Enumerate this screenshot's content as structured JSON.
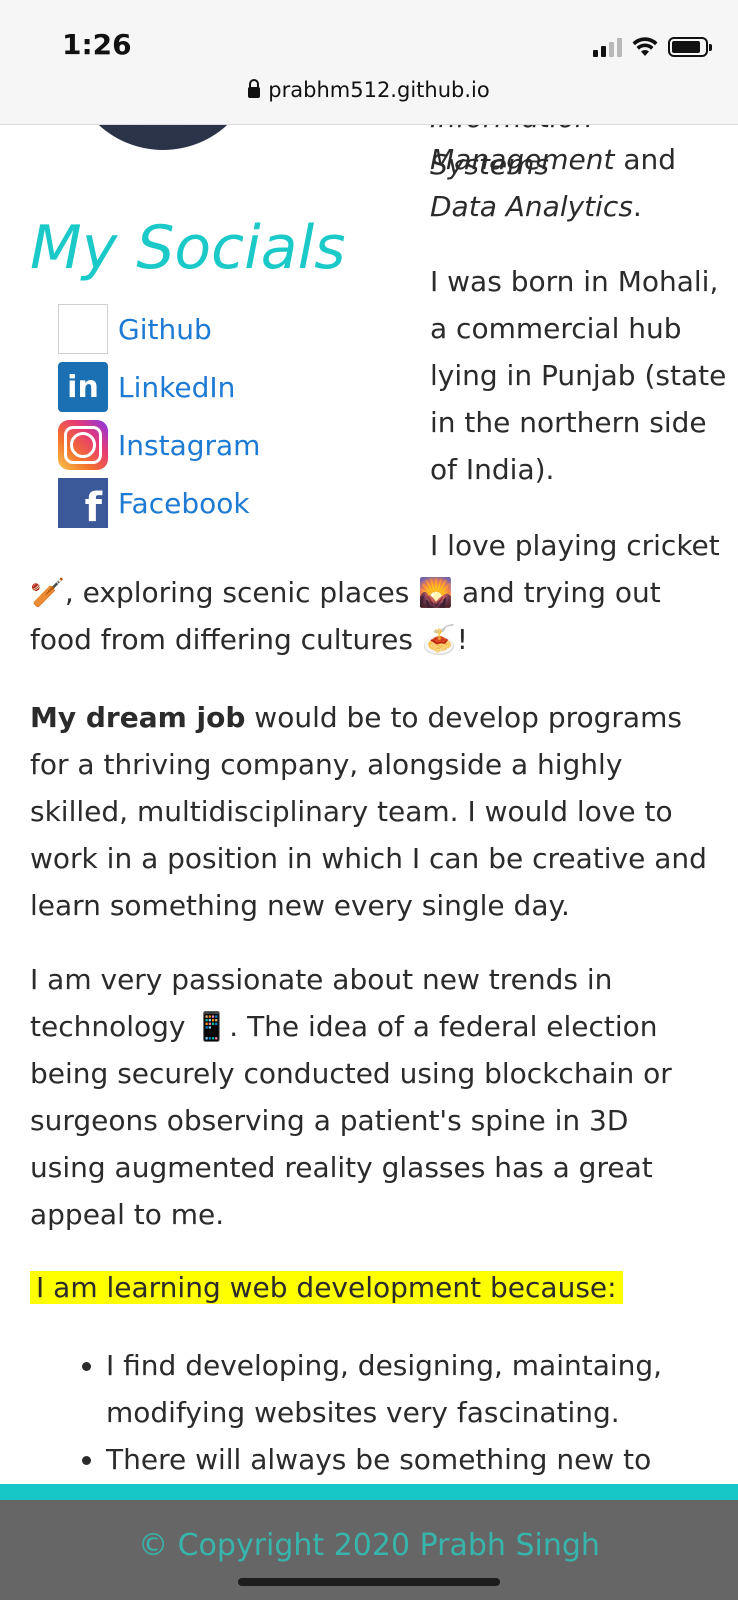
{
  "status_bar": {
    "time": "1:26"
  },
  "browser": {
    "url": "prabhm512.github.io"
  },
  "about": {
    "partial_line": "Information Systems",
    "line_management": "Management",
    "line_and": "and",
    "line_data_analytics": "Data Analytics",
    "period": ".",
    "born_lines": [
      "I was born in Mohali,",
      "a commercial hub",
      "lying in Punjab (state",
      "in the northern side",
      "of India)."
    ],
    "cricket_line1": "I love playing cricket",
    "cricket_line2_a": ", exploring scenic places",
    "cricket_line2_b": "and trying out",
    "cricket_line3_a": "food from differing cultures",
    "cricket_line3_b": "!",
    "dream_bold": "My dream job",
    "dream_rest": " would be to develop programs for a thriving company, alongside a highly skilled, multidisciplinary team. I would love to work in a position in which I can be creative and learn something new every single day.",
    "tech_a": "I am very passionate about new trends in technology",
    "tech_b": ". The idea of a federal election being securely conducted using blockchain or surgeons observing a patient's spine in 3D using augmented reality glasses has a great appeal to me.",
    "learning_heading": "I am learning web development because:",
    "reasons": [
      "I find developing, designing, maintaing, modifying websites very fascinating.",
      "There will always be something new to"
    ]
  },
  "emojis": {
    "cricket": "🏏",
    "scenic": "🌄",
    "food": "🍝",
    "phone": "📱"
  },
  "socials": {
    "title": "My Socials",
    "items": [
      {
        "label": "Github",
        "icon": "github-icon"
      },
      {
        "label": "LinkedIn",
        "icon": "linkedin-icon"
      },
      {
        "label": "Instagram",
        "icon": "instagram-icon"
      },
      {
        "label": "Facebook",
        "icon": "facebook-icon"
      }
    ]
  },
  "footer": {
    "text": "© Copyright 2020 Prabh Singh"
  },
  "colors": {
    "accent": "#1ac9c8",
    "link": "#1e7bd4",
    "highlight": "#ffff00",
    "footer_bg": "#666666",
    "footer_text": "#37b5ad"
  }
}
